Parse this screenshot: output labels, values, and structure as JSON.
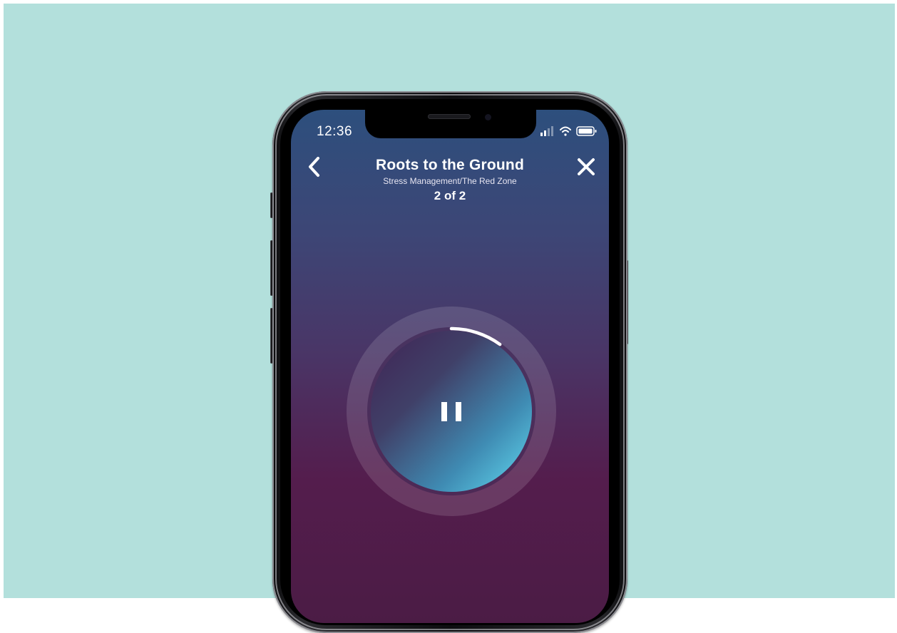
{
  "status_bar": {
    "time": "12:36",
    "signal_icon": "signal-bars-icon",
    "wifi_icon": "wifi-icon",
    "battery_icon": "battery-icon"
  },
  "header": {
    "back_icon": "chevron-left-icon",
    "close_icon": "close-icon",
    "title": "Roots to the Ground",
    "subtitle": "Stress Management/The Red Zone",
    "progress": "2 of 2"
  },
  "player": {
    "control_icon": "pause-icon",
    "playback_fraction": 0.1
  },
  "colors": {
    "background": "#b3e0dc",
    "screen_top": "#2d4f7d",
    "screen_bottom": "#4b1c45",
    "orb_light": "#5fd6ef",
    "orb_dark": "#452c5f",
    "text": "#ffffff"
  }
}
